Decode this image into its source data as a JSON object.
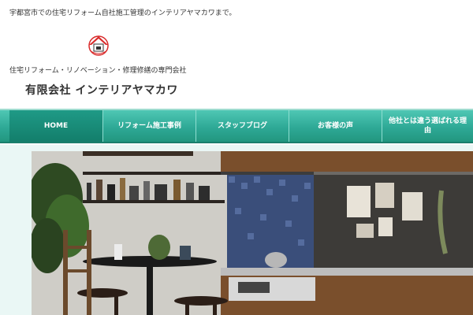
{
  "header": {
    "tagline": "宇都宮市での住宅リフォーム自社施工管理のインテリアヤマカワまで。",
    "subtitle": "住宅リフォーム・リノベーション・修理修繕の専門会社",
    "company_name": "有限会社 インテリアヤマカワ",
    "logo_icon": "house-logo-icon"
  },
  "nav": {
    "items": [
      {
        "label": "HOME",
        "active": true
      },
      {
        "label": "リフォーム施工事例"
      },
      {
        "label": "スタッフブログ"
      },
      {
        "label": "お客様の声"
      },
      {
        "label": "他社とは違う選ばれる理由"
      }
    ]
  },
  "colors": {
    "nav": "#2ea996",
    "nav_active": "#137e6b",
    "logo_red": "#d92b2b"
  }
}
